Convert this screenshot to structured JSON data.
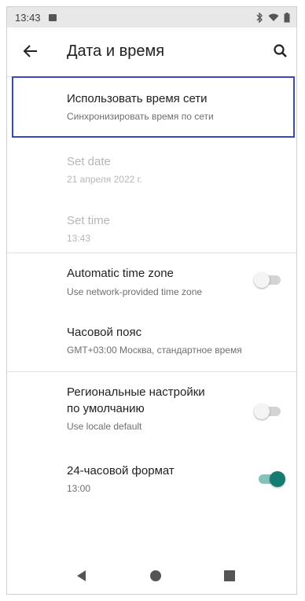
{
  "status_bar": {
    "time": "13:43",
    "icons": [
      "notification-icon",
      "bluetooth-icon",
      "wifi-icon",
      "battery-icon"
    ]
  },
  "app_bar": {
    "title": "Дата и время",
    "back_icon": "arrow-back-icon",
    "search_icon": "search-icon"
  },
  "items": {
    "network_time": {
      "title": "Использовать время сети",
      "summary": "Синхронизировать время по сети"
    },
    "set_date": {
      "title": "Set date",
      "summary": "21 апреля 2022 г."
    },
    "set_time": {
      "title": "Set time",
      "summary": "13:43"
    },
    "auto_timezone": {
      "title": "Automatic time zone",
      "summary": "Use network-provided time zone",
      "enabled": false
    },
    "timezone": {
      "title": "Часовой пояс",
      "summary": "GMT+03:00 Москва, стандартное время"
    },
    "regional": {
      "title_line1": "Региональные настройки",
      "title_line2": "по умолчанию",
      "summary": "Use locale default",
      "enabled": false
    },
    "format_24h": {
      "title": "24-часовой формат",
      "summary": "13:00",
      "enabled": true
    }
  },
  "colors": {
    "accent": "#147c70",
    "highlight_border": "#3946c8",
    "disabled_text": "#b7b7b7"
  },
  "nav_bar": {
    "icons": [
      "nav-back-icon",
      "nav-home-icon",
      "nav-recents-icon"
    ]
  }
}
